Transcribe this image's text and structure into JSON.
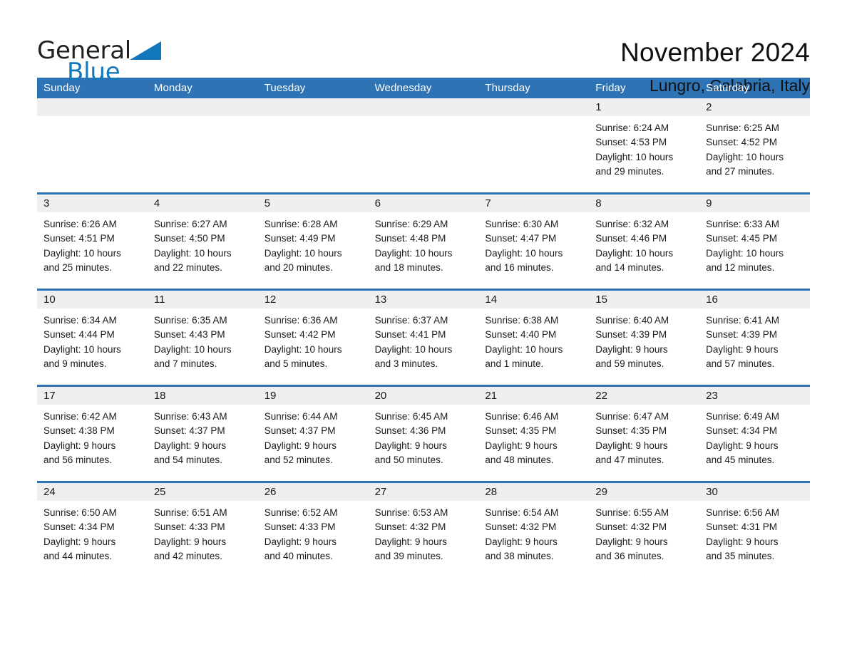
{
  "brand": {
    "name_part1": "General",
    "name_part2": "Blue",
    "triangle_color": "#1277bb"
  },
  "header": {
    "title": "November 2024",
    "location": "Lungro, Calabria, Italy"
  },
  "theme": {
    "header_blue": "#2e74b5",
    "daynum_band": "#efefef",
    "text": "#1a1a1a"
  },
  "calendar": {
    "day_headers": [
      "Sunday",
      "Monday",
      "Tuesday",
      "Wednesday",
      "Thursday",
      "Friday",
      "Saturday"
    ],
    "labels": {
      "sunrise": "Sunrise:",
      "sunset": "Sunset:",
      "daylight": "Daylight:"
    },
    "weeks": [
      [
        {
          "day": "",
          "empty": true
        },
        {
          "day": "",
          "empty": true
        },
        {
          "day": "",
          "empty": true
        },
        {
          "day": "",
          "empty": true
        },
        {
          "day": "",
          "empty": true
        },
        {
          "day": "1",
          "sunrise": "Sunrise: 6:24 AM",
          "sunset": "Sunset: 4:53 PM",
          "daylight_line1": "Daylight: 10 hours",
          "daylight_line2": "and 29 minutes."
        },
        {
          "day": "2",
          "sunrise": "Sunrise: 6:25 AM",
          "sunset": "Sunset: 4:52 PM",
          "daylight_line1": "Daylight: 10 hours",
          "daylight_line2": "and 27 minutes."
        }
      ],
      [
        {
          "day": "3",
          "sunrise": "Sunrise: 6:26 AM",
          "sunset": "Sunset: 4:51 PM",
          "daylight_line1": "Daylight: 10 hours",
          "daylight_line2": "and 25 minutes."
        },
        {
          "day": "4",
          "sunrise": "Sunrise: 6:27 AM",
          "sunset": "Sunset: 4:50 PM",
          "daylight_line1": "Daylight: 10 hours",
          "daylight_line2": "and 22 minutes."
        },
        {
          "day": "5",
          "sunrise": "Sunrise: 6:28 AM",
          "sunset": "Sunset: 4:49 PM",
          "daylight_line1": "Daylight: 10 hours",
          "daylight_line2": "and 20 minutes."
        },
        {
          "day": "6",
          "sunrise": "Sunrise: 6:29 AM",
          "sunset": "Sunset: 4:48 PM",
          "daylight_line1": "Daylight: 10 hours",
          "daylight_line2": "and 18 minutes."
        },
        {
          "day": "7",
          "sunrise": "Sunrise: 6:30 AM",
          "sunset": "Sunset: 4:47 PM",
          "daylight_line1": "Daylight: 10 hours",
          "daylight_line2": "and 16 minutes."
        },
        {
          "day": "8",
          "sunrise": "Sunrise: 6:32 AM",
          "sunset": "Sunset: 4:46 PM",
          "daylight_line1": "Daylight: 10 hours",
          "daylight_line2": "and 14 minutes."
        },
        {
          "day": "9",
          "sunrise": "Sunrise: 6:33 AM",
          "sunset": "Sunset: 4:45 PM",
          "daylight_line1": "Daylight: 10 hours",
          "daylight_line2": "and 12 minutes."
        }
      ],
      [
        {
          "day": "10",
          "sunrise": "Sunrise: 6:34 AM",
          "sunset": "Sunset: 4:44 PM",
          "daylight_line1": "Daylight: 10 hours",
          "daylight_line2": "and 9 minutes."
        },
        {
          "day": "11",
          "sunrise": "Sunrise: 6:35 AM",
          "sunset": "Sunset: 4:43 PM",
          "daylight_line1": "Daylight: 10 hours",
          "daylight_line2": "and 7 minutes."
        },
        {
          "day": "12",
          "sunrise": "Sunrise: 6:36 AM",
          "sunset": "Sunset: 4:42 PM",
          "daylight_line1": "Daylight: 10 hours",
          "daylight_line2": "and 5 minutes."
        },
        {
          "day": "13",
          "sunrise": "Sunrise: 6:37 AM",
          "sunset": "Sunset: 4:41 PM",
          "daylight_line1": "Daylight: 10 hours",
          "daylight_line2": "and 3 minutes."
        },
        {
          "day": "14",
          "sunrise": "Sunrise: 6:38 AM",
          "sunset": "Sunset: 4:40 PM",
          "daylight_line1": "Daylight: 10 hours",
          "daylight_line2": "and 1 minute."
        },
        {
          "day": "15",
          "sunrise": "Sunrise: 6:40 AM",
          "sunset": "Sunset: 4:39 PM",
          "daylight_line1": "Daylight: 9 hours",
          "daylight_line2": "and 59 minutes."
        },
        {
          "day": "16",
          "sunrise": "Sunrise: 6:41 AM",
          "sunset": "Sunset: 4:39 PM",
          "daylight_line1": "Daylight: 9 hours",
          "daylight_line2": "and 57 minutes."
        }
      ],
      [
        {
          "day": "17",
          "sunrise": "Sunrise: 6:42 AM",
          "sunset": "Sunset: 4:38 PM",
          "daylight_line1": "Daylight: 9 hours",
          "daylight_line2": "and 56 minutes."
        },
        {
          "day": "18",
          "sunrise": "Sunrise: 6:43 AM",
          "sunset": "Sunset: 4:37 PM",
          "daylight_line1": "Daylight: 9 hours",
          "daylight_line2": "and 54 minutes."
        },
        {
          "day": "19",
          "sunrise": "Sunrise: 6:44 AM",
          "sunset": "Sunset: 4:37 PM",
          "daylight_line1": "Daylight: 9 hours",
          "daylight_line2": "and 52 minutes."
        },
        {
          "day": "20",
          "sunrise": "Sunrise: 6:45 AM",
          "sunset": "Sunset: 4:36 PM",
          "daylight_line1": "Daylight: 9 hours",
          "daylight_line2": "and 50 minutes."
        },
        {
          "day": "21",
          "sunrise": "Sunrise: 6:46 AM",
          "sunset": "Sunset: 4:35 PM",
          "daylight_line1": "Daylight: 9 hours",
          "daylight_line2": "and 48 minutes."
        },
        {
          "day": "22",
          "sunrise": "Sunrise: 6:47 AM",
          "sunset": "Sunset: 4:35 PM",
          "daylight_line1": "Daylight: 9 hours",
          "daylight_line2": "and 47 minutes."
        },
        {
          "day": "23",
          "sunrise": "Sunrise: 6:49 AM",
          "sunset": "Sunset: 4:34 PM",
          "daylight_line1": "Daylight: 9 hours",
          "daylight_line2": "and 45 minutes."
        }
      ],
      [
        {
          "day": "24",
          "sunrise": "Sunrise: 6:50 AM",
          "sunset": "Sunset: 4:34 PM",
          "daylight_line1": "Daylight: 9 hours",
          "daylight_line2": "and 44 minutes."
        },
        {
          "day": "25",
          "sunrise": "Sunrise: 6:51 AM",
          "sunset": "Sunset: 4:33 PM",
          "daylight_line1": "Daylight: 9 hours",
          "daylight_line2": "and 42 minutes."
        },
        {
          "day": "26",
          "sunrise": "Sunrise: 6:52 AM",
          "sunset": "Sunset: 4:33 PM",
          "daylight_line1": "Daylight: 9 hours",
          "daylight_line2": "and 40 minutes."
        },
        {
          "day": "27",
          "sunrise": "Sunrise: 6:53 AM",
          "sunset": "Sunset: 4:32 PM",
          "daylight_line1": "Daylight: 9 hours",
          "daylight_line2": "and 39 minutes."
        },
        {
          "day": "28",
          "sunrise": "Sunrise: 6:54 AM",
          "sunset": "Sunset: 4:32 PM",
          "daylight_line1": "Daylight: 9 hours",
          "daylight_line2": "and 38 minutes."
        },
        {
          "day": "29",
          "sunrise": "Sunrise: 6:55 AM",
          "sunset": "Sunset: 4:32 PM",
          "daylight_line1": "Daylight: 9 hours",
          "daylight_line2": "and 36 minutes."
        },
        {
          "day": "30",
          "sunrise": "Sunrise: 6:56 AM",
          "sunset": "Sunset: 4:31 PM",
          "daylight_line1": "Daylight: 9 hours",
          "daylight_line2": "and 35 minutes."
        }
      ]
    ]
  }
}
